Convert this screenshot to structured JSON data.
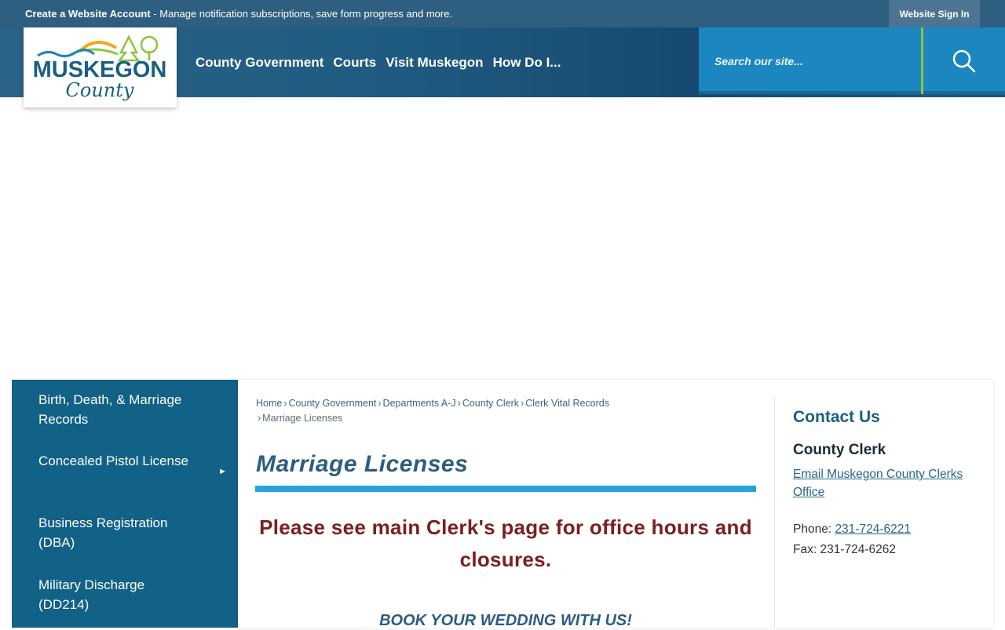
{
  "topbar": {
    "create_account_bold": "Create a Website Account",
    "create_account_text": " - Manage notification subscriptions, save form progress and more.",
    "sign_in": "Website Sign In"
  },
  "logo": {
    "line1": "MUSKEGON",
    "line2": "County"
  },
  "nav": {
    "items": [
      "County Government",
      "Courts",
      "Visit Muskegon",
      "How Do I..."
    ]
  },
  "search": {
    "placeholder": "Search our site..."
  },
  "sidebar": {
    "items": [
      {
        "label": "Birth, Death, & Marriage Records",
        "has_submenu": false
      },
      {
        "label": "Concealed Pistol License",
        "has_submenu": true,
        "arrow": "►"
      },
      {
        "label": "Business Registration (DBA)",
        "has_submenu": false
      },
      {
        "label": "Military Discharge (DD214)",
        "has_submenu": false
      }
    ]
  },
  "breadcrumb": {
    "items": [
      "Home",
      "County Government",
      "Departments A-J",
      "County Clerk",
      "Clerk Vital Records"
    ],
    "current": "Marriage Licenses",
    "separator": "›"
  },
  "main": {
    "title": "Marriage Licenses",
    "notice": "Please see main Clerk's page for office hours and closures.",
    "book_heading": "BOOK YOUR WEDDING WITH US!"
  },
  "contact": {
    "heading": "Contact Us",
    "name": "County Clerk",
    "email_link": "Email Muskegon County Clerks Office",
    "phone_label": "Phone: ",
    "phone": "231-724-6221",
    "fax": "Fax: 231-724-6262"
  },
  "colors": {
    "topbar": "#2f5f80",
    "sidebar": "#126186",
    "accent_bar": "#27a3dc",
    "search_bg": "#1b86c0",
    "search_divider": "#8cc63f",
    "notice_text": "#7a1f1f",
    "title_text": "#2c5d80"
  }
}
